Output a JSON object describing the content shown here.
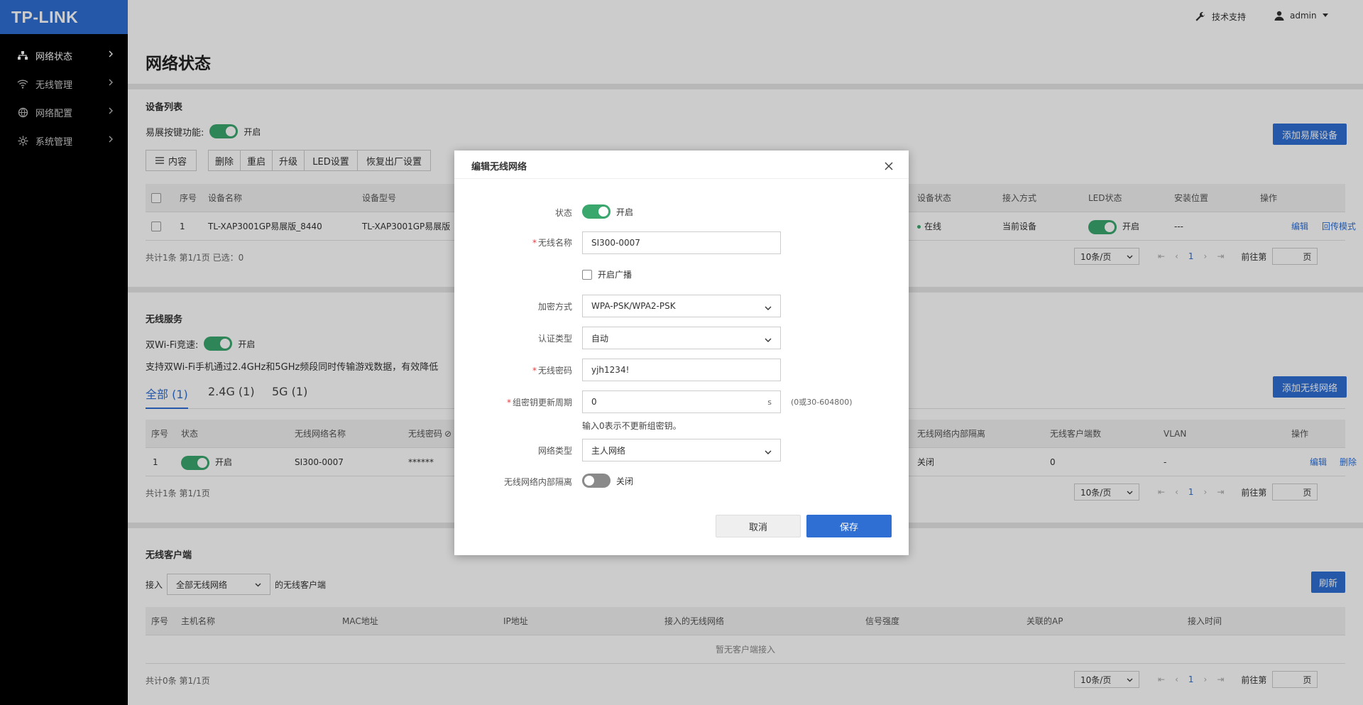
{
  "brand": {
    "logo": "TP-LINK",
    "accent": "#2f6fd3",
    "green": "#3aa76d"
  },
  "sidebar": {
    "items": [
      {
        "label": "网络状态",
        "icon": "network-topology-icon",
        "active": true
      },
      {
        "label": "无线管理",
        "icon": "wifi-icon",
        "active": false
      },
      {
        "label": "网络配置",
        "icon": "globe-icon",
        "active": false
      },
      {
        "label": "系统管理",
        "icon": "gear-icon",
        "active": false
      }
    ]
  },
  "topbar": {
    "support": "技术支持",
    "user": "admin"
  },
  "page": {
    "title": "网络状态"
  },
  "devices": {
    "title": "设备列表",
    "easy_label": "易展按键功能:",
    "easy_state": "开启",
    "add_button": "添加易展设备",
    "content_btn": "内容",
    "actions": [
      "删除",
      "重启",
      "升级",
      "LED设置",
      "恢复出厂设置"
    ],
    "headers": {
      "num": "序号",
      "name": "设备名称",
      "model": "设备型号",
      "status": "设备状态",
      "access": "接入方式",
      "led": "LED状态",
      "location": "安装位置",
      "ops": "操作"
    },
    "rows": [
      {
        "num": "1",
        "name": "TL-XAP3001GP易展版_8440",
        "model": "TL-XAP3001GP易展版",
        "status": "在线",
        "access": "当前设备",
        "led": "开启",
        "location": "---",
        "edit": "编辑",
        "mode": "回传模式"
      }
    ],
    "summary": "共计1条  第1/1页  已选：0"
  },
  "wireless": {
    "title": "无线服务",
    "dual_label": "双Wi-Fi竞速:",
    "dual_state": "开启",
    "desc": "支持双Wi-Fi手机通过2.4GHz和5GHz频段同时传输游戏数据，有效降低",
    "add_button": "添加无线网络",
    "tabs": [
      "全部 (1)",
      "2.4G (1)",
      "5G (1)"
    ],
    "headers": {
      "num": "序号",
      "status": "状态",
      "ssid": "无线网络名称",
      "pwd": "无线密码",
      "iso": "无线网络内部隔离",
      "clients": "无线客户端数",
      "vlan": "VLAN",
      "ops": "操作"
    },
    "rows": [
      {
        "num": "1",
        "status": "开启",
        "ssid": "SI300-0007",
        "pwd": "******",
        "iso": "关闭",
        "clients": "0",
        "vlan": "-",
        "edit": "编辑",
        "del": "删除"
      }
    ],
    "summary": "共计1条  第1/1页"
  },
  "clients": {
    "title": "无线客户端",
    "prefix": "接入",
    "select": "全部无线网络",
    "suffix": "的无线客户端",
    "refresh": "刷新",
    "headers": {
      "num": "序号",
      "host": "主机名称",
      "mac": "MAC地址",
      "ip": "IP地址",
      "ssid": "接入的无线网络",
      "signal": "信号强度",
      "ap": "关联的AP",
      "time": "接入时间"
    },
    "empty": "暂无客户端接入",
    "summary": "共计0条  第1/1页"
  },
  "pager": {
    "size": "10条/页",
    "current": "1",
    "goto": "前往第",
    "page": "页"
  },
  "modal": {
    "title": "编辑无线网络",
    "status_label": "状态",
    "status_value": "开启",
    "ssid_label": "无线名称",
    "ssid_value": "SI300-0007",
    "broadcast_label": "开启广播",
    "enc_label": "加密方式",
    "enc_value": "WPA-PSK/WPA2-PSK",
    "auth_label": "认证类型",
    "auth_value": "自动",
    "pwd_label": "无线密码",
    "pwd_value": "yjh1234!",
    "rekey_label": "组密钥更新周期",
    "rekey_value": "0",
    "rekey_unit": "s",
    "rekey_range": "(0或30-604800)",
    "rekey_hint": "输入0表示不更新组密钥。",
    "nettype_label": "网络类型",
    "nettype_value": "主人网络",
    "iso_label": "无线网络内部隔离",
    "iso_value": "关闭",
    "cancel": "取消",
    "save": "保存"
  }
}
